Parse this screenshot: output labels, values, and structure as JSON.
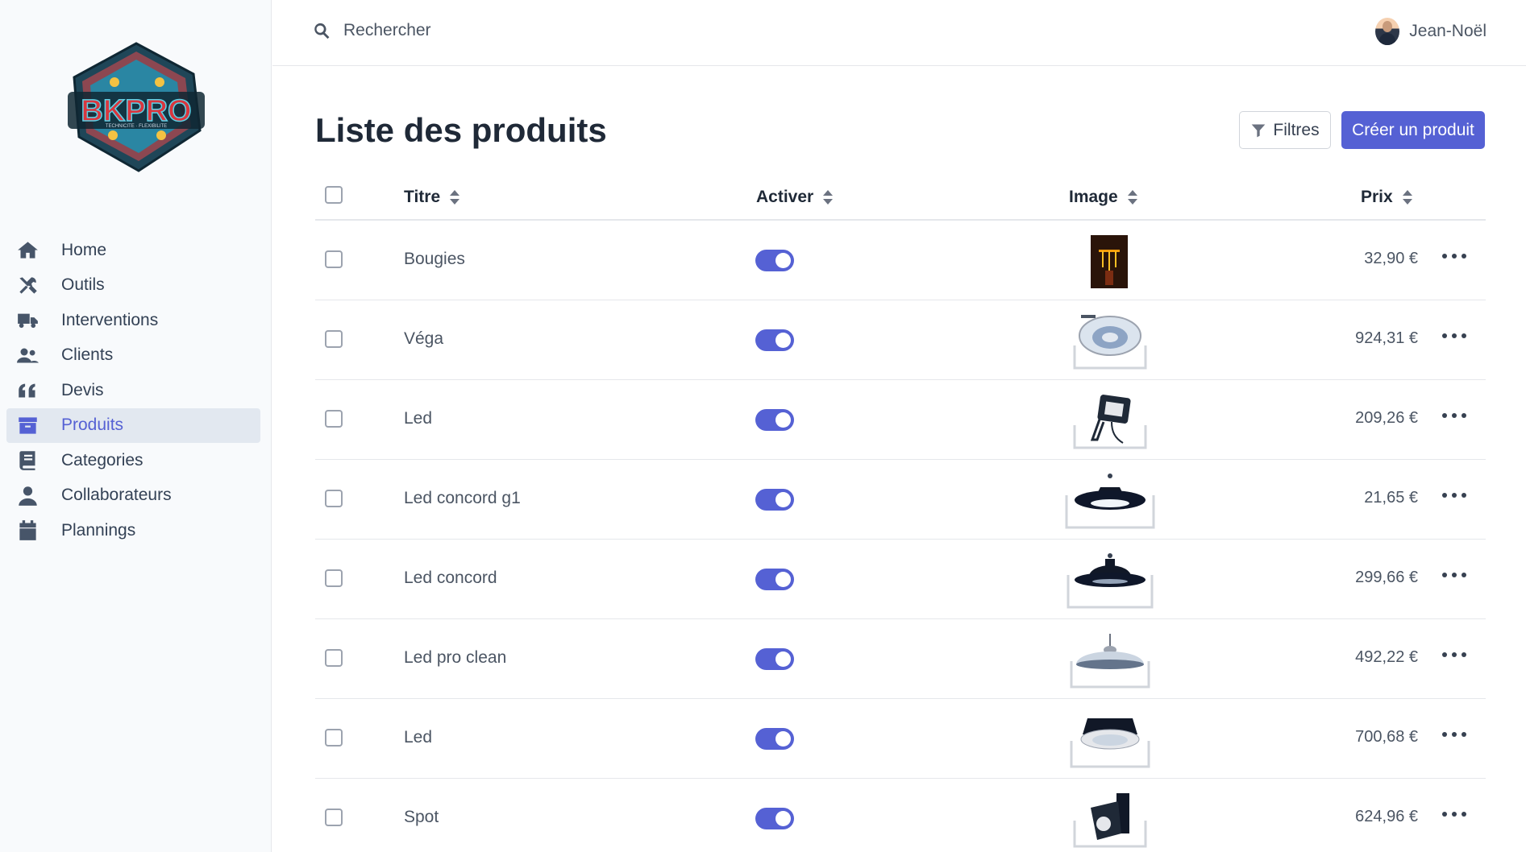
{
  "brand": {
    "logo_text": "BKPRO",
    "logo_tagline": "TECHNICITE · FLEXIBILITE",
    "accent": "#5561d4"
  },
  "sidebar": {
    "items": [
      {
        "label": "Home",
        "icon": "home-icon",
        "active": false
      },
      {
        "label": "Outils",
        "icon": "tools-icon",
        "active": false
      },
      {
        "label": "Interventions",
        "icon": "truck-icon",
        "active": false
      },
      {
        "label": "Clients",
        "icon": "users-icon",
        "active": false
      },
      {
        "label": "Devis",
        "icon": "quote-icon",
        "active": false
      },
      {
        "label": "Produits",
        "icon": "archive-icon",
        "active": true
      },
      {
        "label": "Categories",
        "icon": "book-icon",
        "active": false
      },
      {
        "label": "Collaborateurs",
        "icon": "user-icon",
        "active": false
      },
      {
        "label": "Plannings",
        "icon": "calendar-icon",
        "active": false
      }
    ]
  },
  "header": {
    "search_placeholder": "Rechercher",
    "user_name": "Jean-Noël"
  },
  "page": {
    "title": "Liste des produits",
    "filter_label": "Filtres",
    "create_label": "Créer un produit"
  },
  "table": {
    "columns": {
      "title": "Titre",
      "active": "Activer",
      "image": "Image",
      "price": "Prix"
    },
    "rows": [
      {
        "title": "Bougies",
        "active": true,
        "image": "candles-image",
        "price": "32,90 €"
      },
      {
        "title": "Véga",
        "active": true,
        "image": "downlight-image",
        "price": "924,31 €"
      },
      {
        "title": "Led",
        "active": true,
        "image": "floodlight-image",
        "price": "209,26 €"
      },
      {
        "title": "Led concord g1",
        "active": true,
        "image": "highbay-ufo-image",
        "price": "21,65 €"
      },
      {
        "title": "Led concord",
        "active": true,
        "image": "highbay-dome-image",
        "price": "299,66 €"
      },
      {
        "title": "Led pro clean",
        "active": true,
        "image": "highbay-clean-image",
        "price": "492,22 €"
      },
      {
        "title": "Led",
        "active": true,
        "image": "recessed-led-image",
        "price": "700,68 €"
      },
      {
        "title": "Spot",
        "active": true,
        "image": "track-spot-image",
        "price": "624,96 €"
      }
    ]
  }
}
